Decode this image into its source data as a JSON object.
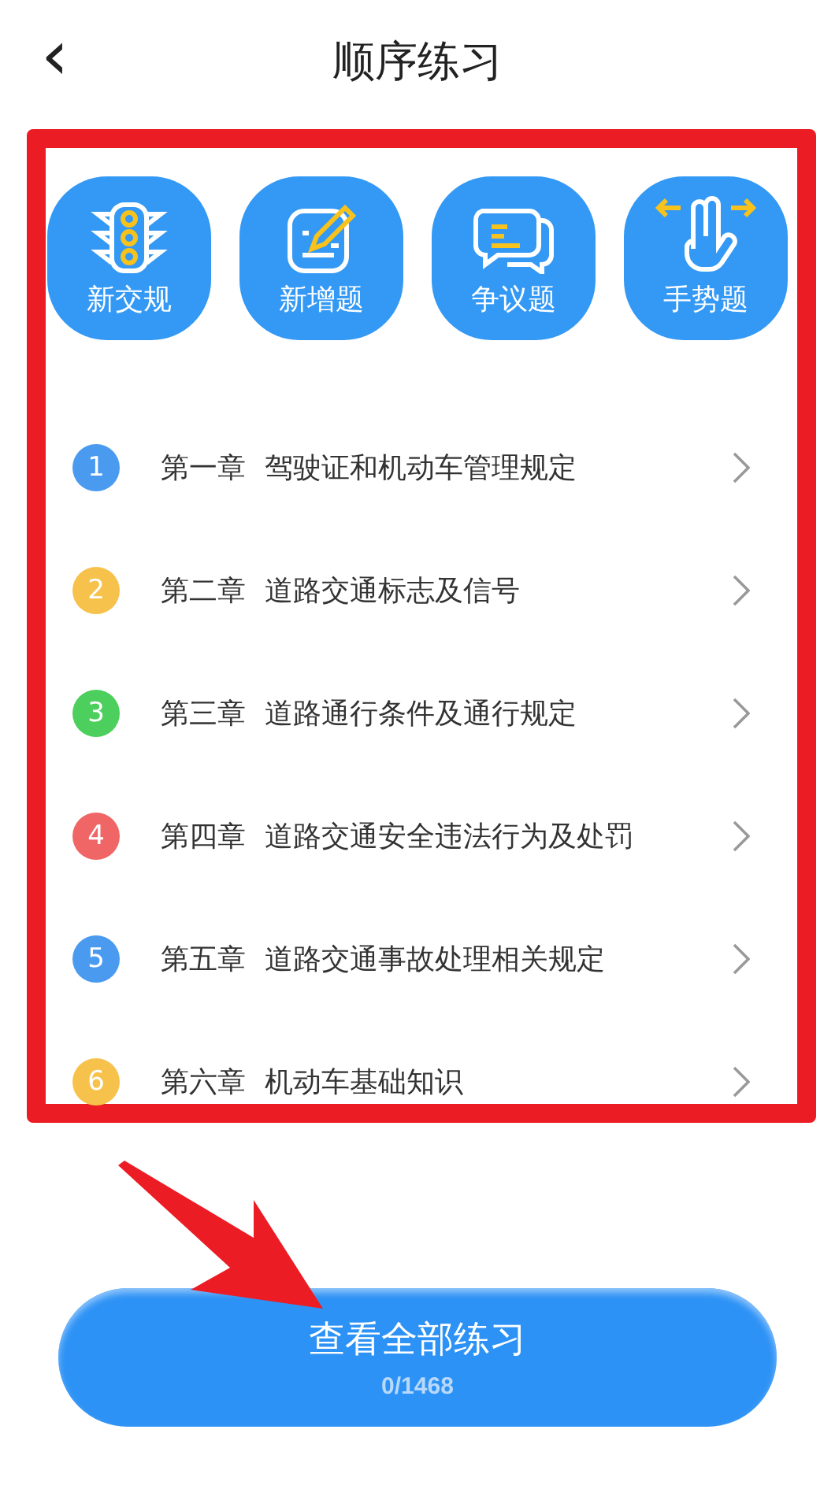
{
  "header": {
    "back_icon": "‹",
    "title": "顺序练习"
  },
  "categories": [
    {
      "label": "新交规"
    },
    {
      "label": "新增题"
    },
    {
      "label": "争议题"
    },
    {
      "label": "手势题"
    }
  ],
  "chapters": [
    {
      "index": "1",
      "chapter": "第一章",
      "title": "驾驶证和机动车管理规定",
      "color": "#4a9bf0"
    },
    {
      "index": "2",
      "chapter": "第二章",
      "title": "道路交通标志及信号",
      "color": "#f7c24c"
    },
    {
      "index": "3",
      "chapter": "第三章",
      "title": "道路通行条件及通行规定",
      "color": "#4ccf5c"
    },
    {
      "index": "4",
      "chapter": "第四章",
      "title": "道路交通安全违法行为及处罚",
      "color": "#f06565"
    },
    {
      "index": "5",
      "chapter": "第五章",
      "title": "道路交通事故处理相关规定",
      "color": "#4a9bf0"
    },
    {
      "index": "6",
      "chapter": "第六章",
      "title": "机动车基础知识",
      "color": "#f7c24c"
    }
  ],
  "main_button": {
    "label": "查看全部练习",
    "progress": "0/1468"
  }
}
